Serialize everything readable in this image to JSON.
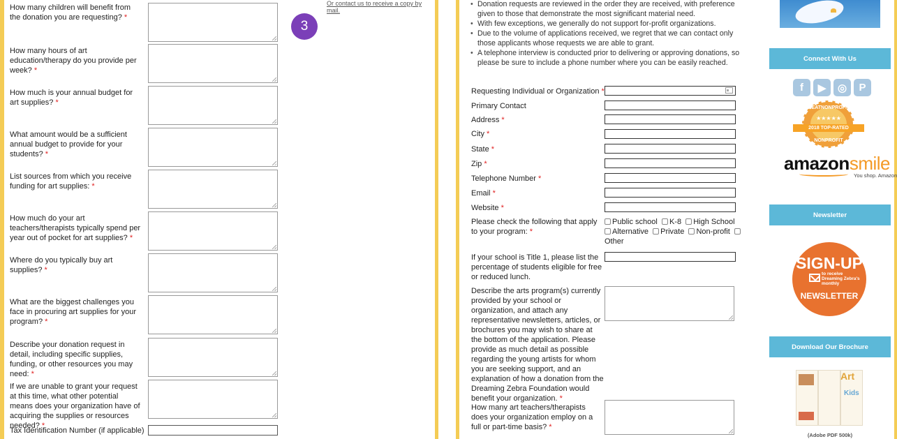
{
  "left": {
    "questions": [
      {
        "label": "How many children will benefit from the donation you are requesting?"
      },
      {
        "label": "How many hours of art education/therapy do you provide per week?"
      },
      {
        "label": "How much is your annual budget for art supplies?"
      },
      {
        "label": "What amount would be a sufficient annual budget to provide for your students?"
      },
      {
        "label": "List sources from which you receive funding for art supplies:"
      },
      {
        "label": "How much do your art teachers/therapists typically spend per year out of pocket for art supplies?"
      },
      {
        "label": "Where do you typically buy art supplies?"
      },
      {
        "label": "What are the biggest challenges you face in procuring art supplies for your program?"
      },
      {
        "label": "Describe your donation request in detail, including specific supplies, funding, or other resources you may need:"
      },
      {
        "label": "If we are unable to grant your request at this time, what other potential means does your organization have of acquiring the supplies or resources needed?"
      }
    ],
    "required_mark": "*",
    "tax_label": "Tax Identification Number (if applicable)",
    "step_number": "3",
    "mail_link": "Or contact us to receive a copy by mail."
  },
  "right": {
    "bullets": [
      "Donation requests are reviewed in the order they are received, with preference given to those that demonstrate the most significant material need.",
      "With few exceptions, we generally do not support for-profit organizations.",
      "Due to the volume of applications received, we regret that we can contact only those applicants whose requests we are able to grant.",
      "A telephone interview is conducted prior to delivering or approving donations, so please be sure to include a phone number where you can be easily reached."
    ],
    "fields": [
      {
        "label": "Requesting Individual or Organization",
        "required": true
      },
      {
        "label": "Primary Contact",
        "required": false
      },
      {
        "label": "Address",
        "required": true
      },
      {
        "label": "City",
        "required": true
      },
      {
        "label": "State",
        "required": true
      },
      {
        "label": "Zip",
        "required": true
      },
      {
        "label": "Telephone Number",
        "required": true
      },
      {
        "label": "Email",
        "required": true
      },
      {
        "label": "Website",
        "required": true
      }
    ],
    "program_label": "Please check the following that apply to your program:",
    "program_options": [
      "Public school",
      "K-8",
      "High School",
      "Alternative",
      "Private",
      "Non-profit",
      "Other"
    ],
    "title1_label": "If your school is Title 1, please list the percentage of students eligible for free or reduced lunch.",
    "describe_label": "Describe the arts program(s) currently provided by your school or organization, and attach any representative newsletters, articles, or brochures you may wish to share at the bottom of the application. Please provide as much detail as possible regarding the young artists for whom you are seeking support, and an explanation of how a donation from the Dreaming Zebra Foundation would benefit your organization.",
    "teachers_label": "How many art teachers/therapists does your organization employ on a full or part-time basis?"
  },
  "sidebar": {
    "connect_heading": "Connect With Us",
    "social_icons": [
      "facebook-icon",
      "youtube-icon",
      "instagram-icon",
      "pinterest-icon"
    ],
    "gnp_top": "GREATNONPROFITS",
    "gnp_banner": "2018 TOP-RATED",
    "gnp_bottom": "NONPROFIT",
    "amazon_word": "amazon",
    "amazon_smile": "smile",
    "amazon_tag": "You shop. Amazon gives.",
    "newsletter_heading": "Newsletter",
    "signup_big": "SIGN-UP",
    "signup_small": "to receive Dreaming Zebra's monthly",
    "signup_news": "NEWSLETTER",
    "brochure_heading": "Download Our Brochure",
    "brochure_art": "Art",
    "brochure_kids": "Kids",
    "brochure_caption": "(Adobe PDF 500k)"
  },
  "colors": {
    "accent_yellow": "#f4cc55",
    "required_red": "#e02020",
    "step_purple": "#7b3fb8",
    "sidebar_blue": "#5cb8d8",
    "signup_orange": "#e8722f"
  }
}
